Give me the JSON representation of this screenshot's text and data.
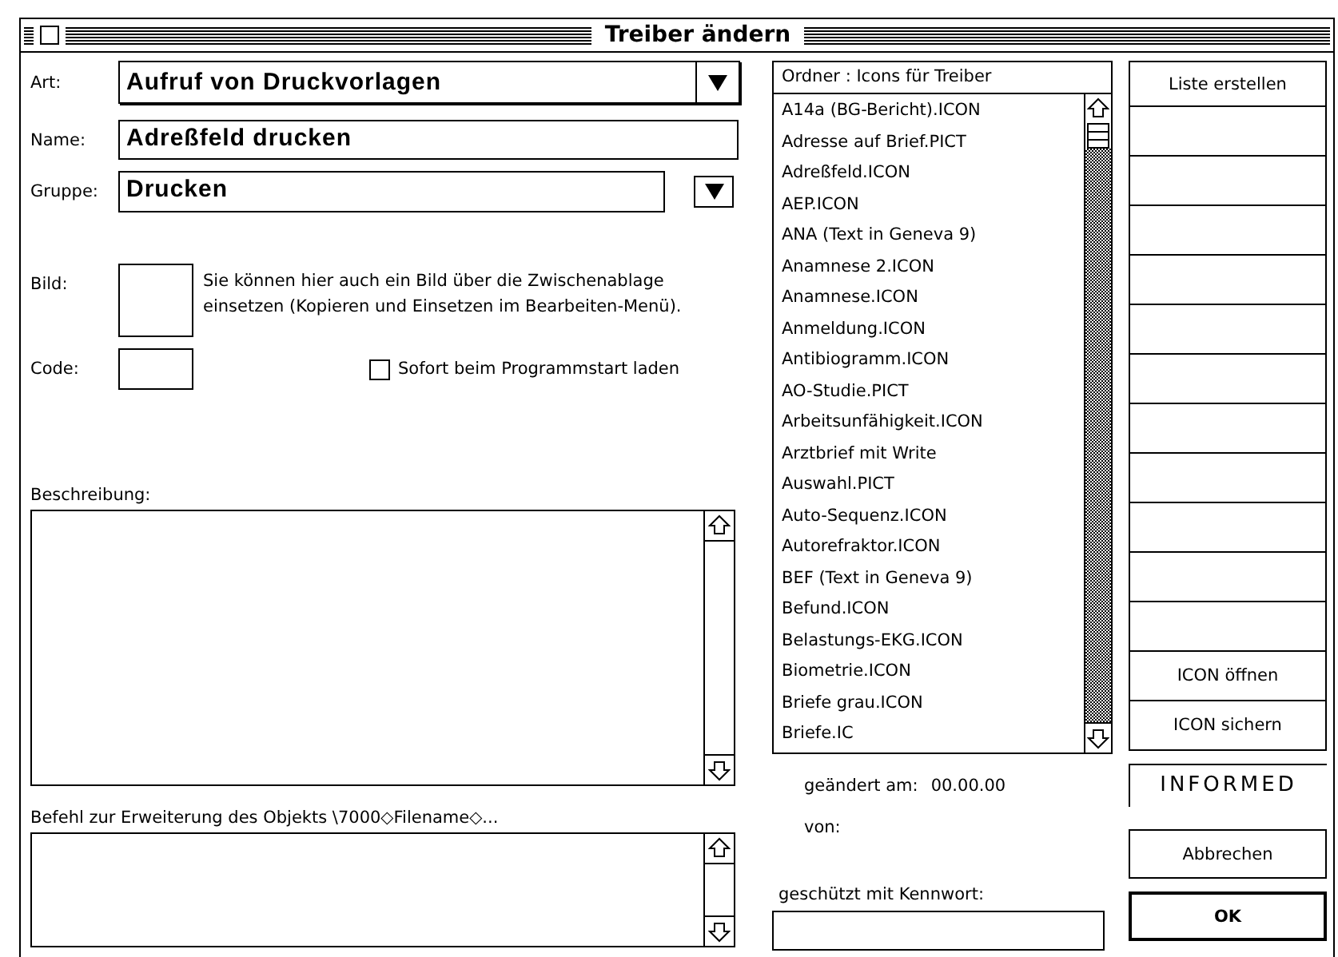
{
  "window": {
    "title": "Treiber ändern"
  },
  "art": {
    "label": "Art:",
    "value": "Aufruf von Druckvorlagen"
  },
  "name": {
    "label": "Name:",
    "value": "Adreßfeld drucken"
  },
  "gruppe": {
    "label": "Gruppe:",
    "value": "Drucken"
  },
  "bild": {
    "label": "Bild:",
    "hint": "Sie können hier auch ein Bild über die Zwischenablage einsetzen (Kopieren und Einsetzen im Bearbeiten-Menü)."
  },
  "code": {
    "label": "Code:"
  },
  "autoload": {
    "label": "Sofort beim Programmstart laden",
    "checked": false
  },
  "beschreibung": {
    "label": "Beschreibung:"
  },
  "befehl": {
    "label": "Befehl zur Erweiterung des Objekts \\7000◇Filename◇..."
  },
  "folder": {
    "header": "Ordner : Icons für Treiber",
    "items": [
      "A14a (BG-Bericht).ICON",
      "Adresse auf Brief.PICT",
      "Adreßfeld.ICON",
      "AEP.ICON",
      "ANA (Text in Geneva 9)",
      "Anamnese 2.ICON",
      "Anamnese.ICON",
      "Anmeldung.ICON",
      "Antibiogramm.ICON",
      "AO-Studie.PICT",
      "Arbeitsunfähigkeit.ICON",
      "Arztbrief mit Write",
      "Auswahl.PICT",
      "Auto-Sequenz.ICON",
      "Autorefraktor.ICON",
      "BEF (Text in Geneva 9)",
      "Befund.ICON",
      "Belastungs-EKG.ICON",
      "Biometrie.ICON",
      "Briefe grau.ICON",
      "Briefe.IC"
    ]
  },
  "changed": {
    "label": "geändert am:",
    "value": "00.00.00"
  },
  "by": {
    "label": "von:"
  },
  "password": {
    "label": "geschützt mit Kennwort:"
  },
  "side_buttons": {
    "top": "Liste erstellen",
    "bottom": [
      "ICON öffnen",
      "ICON sichern"
    ]
  },
  "brand": "INFORMED",
  "buttons": {
    "cancel": "Abbrechen",
    "ok": "OK"
  }
}
